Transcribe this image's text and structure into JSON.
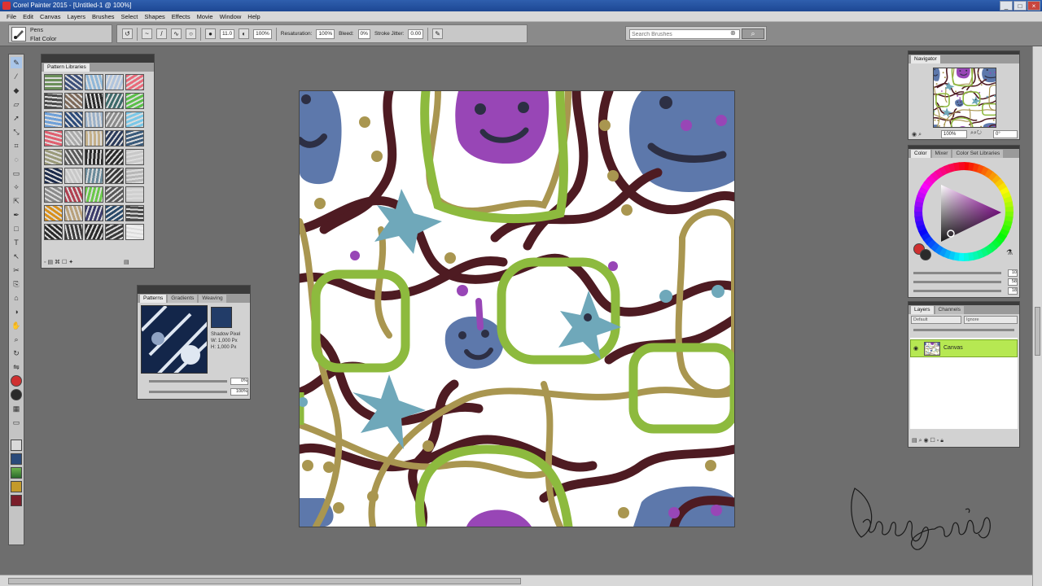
{
  "window": {
    "title": "Corel Painter 2015 - [Untitled-1 @ 100%]"
  },
  "menu": [
    "File",
    "Edit",
    "Canvas",
    "Layers",
    "Brushes",
    "Select",
    "Shapes",
    "Effects",
    "Movie",
    "Window",
    "Help"
  ],
  "brush": {
    "category": "Pens",
    "variant": "Flat Color"
  },
  "properties": {
    "size": "11.0",
    "opacity": "100%",
    "resaturation": "100%",
    "bleed": "0%",
    "stroke_jitter": "0.00",
    "labels": {
      "resaturation": "Resaturation:",
      "bleed": "Bleed:",
      "stroke_jitter": "Stroke Jitter:"
    }
  },
  "search": {
    "placeholder": "Search Brushes"
  },
  "panels": {
    "pattern_libraries": {
      "tab": "Pattern Libraries"
    },
    "patterns": {
      "tabs": [
        "Patterns",
        "Gradients",
        "Weaving"
      ],
      "info_name": "Shadow Pixel",
      "info_w": "W: 1,000 Px",
      "info_h": "H: 1,000 Px",
      "scale_value": "0%",
      "offset_value": "100%"
    },
    "navigator": {
      "tab": "Navigator",
      "zoom": "100%",
      "angle": "0°"
    },
    "color": {
      "tabs": [
        "Color",
        "Mixer",
        "Color Set Libraries"
      ],
      "values": [
        "10",
        "58",
        "18"
      ],
      "primary": "#cf2f2f",
      "secondary": "#2a2a2a"
    },
    "layers": {
      "tabs": [
        "Layers",
        "Channels"
      ],
      "composite_method": "Default",
      "composite_depth": "Ignore",
      "layer_name": "Canvas"
    }
  },
  "colors": {
    "maroon": "#4e1b22",
    "olive": "#a99650",
    "lime": "#8dba3e",
    "teal": "#6fa8ba",
    "slate": "#5d78ab",
    "purple": "#9846b6",
    "dark": "#2d2f44"
  }
}
